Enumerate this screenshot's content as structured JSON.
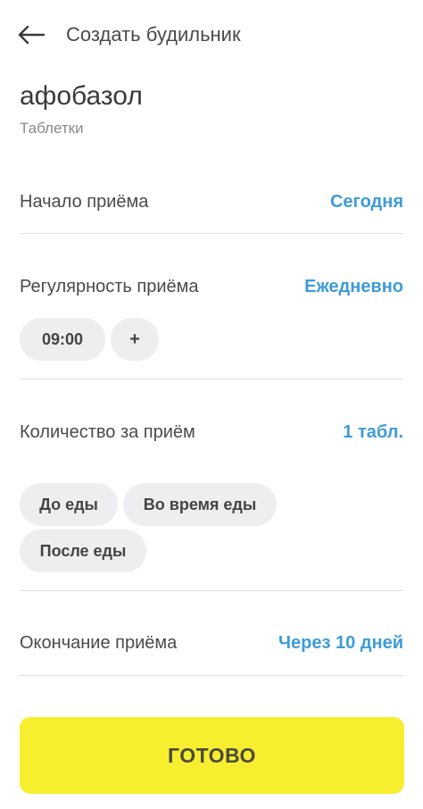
{
  "header": {
    "back_icon": "arrow-left-icon",
    "title": "Создать будильник"
  },
  "medicine": {
    "name": "афобазол",
    "type": "Таблетки"
  },
  "start": {
    "label": "Начало приёма",
    "value": "Сегодня"
  },
  "regularity": {
    "label": "Регулярность приёма",
    "value": "Ежедневно",
    "times": [
      "09:00"
    ],
    "add_label": "+"
  },
  "dose": {
    "label": "Количество за приём",
    "value": "1 табл.",
    "meal_options": [
      "До еды",
      "Во время еды",
      "После еды"
    ]
  },
  "end": {
    "label": "Окончание приёма",
    "value": "Через 10 дней"
  },
  "done_button": {
    "label": "ГОТОВО"
  },
  "colors": {
    "accent": "#3f9bd8",
    "button": "#f7ee2f",
    "chip": "#eeeef0",
    "divider": "#e2e2e2"
  }
}
